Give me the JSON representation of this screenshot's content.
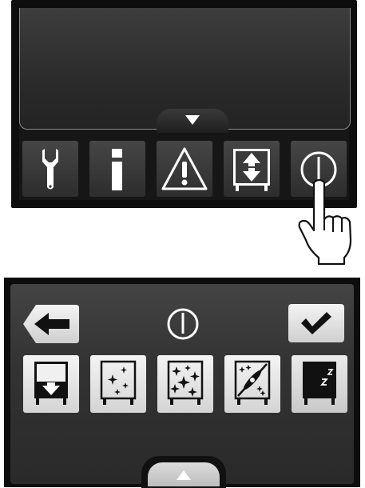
{
  "top_panel": {
    "icons": [
      "wrench-icon",
      "info-icon",
      "warning-icon",
      "door-lift-icon",
      "power-icon"
    ],
    "expand_icon": "chevron-down-icon",
    "hand_icon": "pointing-hand-icon"
  },
  "bottom_panel": {
    "back_icon": "arrow-left-icon",
    "title_icon": "power-icon",
    "confirm_icon": "checkmark-icon",
    "modes": [
      "tray-down-icon",
      "sparkle-small-icon",
      "sparkle-large-icon",
      "sparkle-fan-icon",
      "sleep-icon"
    ],
    "collapse_icon": "chevron-up-icon"
  },
  "colors": {
    "bezel": "#0d0d0d",
    "display": "#2b2b2b",
    "button_light": "#e6e6e6",
    "icon_white": "#ffffff",
    "icon_dark": "#111111"
  }
}
